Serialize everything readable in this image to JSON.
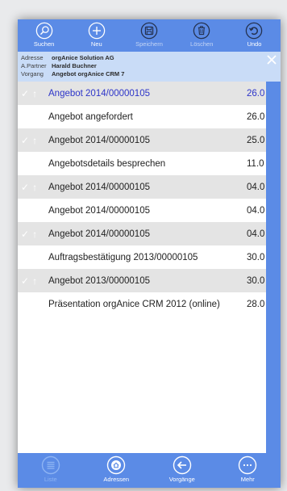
{
  "toolbar": {
    "buttons": [
      {
        "label": "Suchen",
        "icon": "search-icon",
        "enabled": true
      },
      {
        "label": "Neu",
        "icon": "plus-icon",
        "enabled": true
      },
      {
        "label": "Speichern",
        "icon": "save-icon",
        "enabled": false
      },
      {
        "label": "Löschen",
        "icon": "trash-icon",
        "enabled": false
      },
      {
        "label": "Undo",
        "icon": "undo-icon",
        "enabled": true
      }
    ]
  },
  "info": {
    "adresse_label": "Adresse",
    "adresse_value": "orgAnice Solution AG",
    "partner_label": "A.Partner",
    "partner_value": "Harald Buchner",
    "vorgang_label": "Vorgang",
    "vorgang_value": "Angebot orgAnice CRM 7"
  },
  "list": {
    "rows": [
      {
        "title": "Angebot 2014/00000105",
        "date": "26.0",
        "icons": true,
        "alt": true,
        "selected": true
      },
      {
        "title": "Angebot angefordert",
        "date": "26.0",
        "icons": false,
        "alt": false,
        "selected": false
      },
      {
        "title": "Angebot 2014/00000105",
        "date": "25.0",
        "icons": true,
        "alt": true,
        "selected": false
      },
      {
        "title": "Angebotsdetails besprechen",
        "date": "11.0",
        "icons": false,
        "alt": false,
        "selected": false
      },
      {
        "title": "Angebot 2014/00000105",
        "date": "04.0",
        "icons": true,
        "alt": true,
        "selected": false
      },
      {
        "title": "Angebot 2014/00000105",
        "date": "04.0",
        "icons": false,
        "alt": false,
        "selected": false
      },
      {
        "title": "Angebot 2014/00000105",
        "date": "04.0",
        "icons": true,
        "alt": true,
        "selected": false
      },
      {
        "title": "Auftragsbestätigung 2013/00000105",
        "date": "30.0",
        "icons": false,
        "alt": false,
        "selected": false
      },
      {
        "title": "Angebot 2013/00000105",
        "date": "30.0",
        "icons": true,
        "alt": true,
        "selected": false
      },
      {
        "title": "Präsentation orgAnice CRM 2012 (online)",
        "date": "28.0",
        "icons": false,
        "alt": false,
        "selected": false
      }
    ]
  },
  "bottombar": {
    "buttons": [
      {
        "label": "Liste",
        "icon": "list-icon",
        "active": true
      },
      {
        "label": "Adressen",
        "icon": "home-icon",
        "active": false
      },
      {
        "label": "Vorgänge",
        "icon": "arrow-left-icon",
        "active": false
      },
      {
        "label": "Mehr",
        "icon": "more-icon",
        "active": false
      }
    ]
  },
  "colors": {
    "accent": "#5b8be6",
    "info_bg": "#c9dcf7",
    "row_alt": "#e4e4e4",
    "selected_text": "#2d35c9"
  }
}
